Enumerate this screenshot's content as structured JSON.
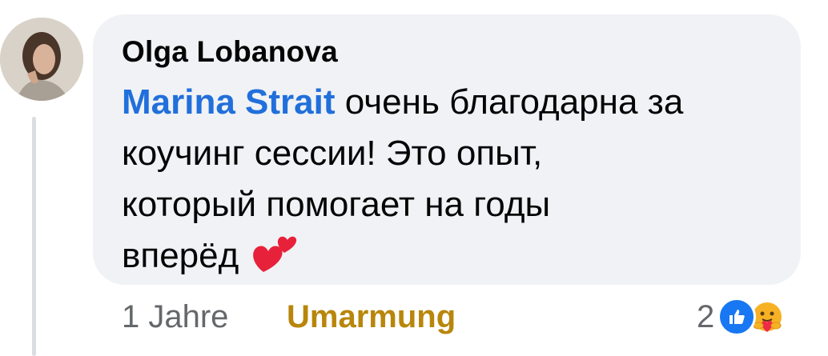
{
  "comment": {
    "author": "Olga Lobanova",
    "mention": "Marina Strait",
    "text_line1": " очень благодарна за",
    "text_line2": "коучинг сессии! Это опыт,",
    "text_line3": "который помогает на годы",
    "text_line4": "вперёд",
    "emoji": "two-hearts"
  },
  "footer": {
    "time": "1 Jahre",
    "reaction_action": "Umarmung",
    "reaction_count": "2",
    "reaction_icons": [
      "like-icon",
      "care-icon"
    ]
  },
  "colors": {
    "bubble": "#f0f2f5",
    "mention": "#216fdb",
    "hug": "#b8860b",
    "meta": "#65676b"
  }
}
